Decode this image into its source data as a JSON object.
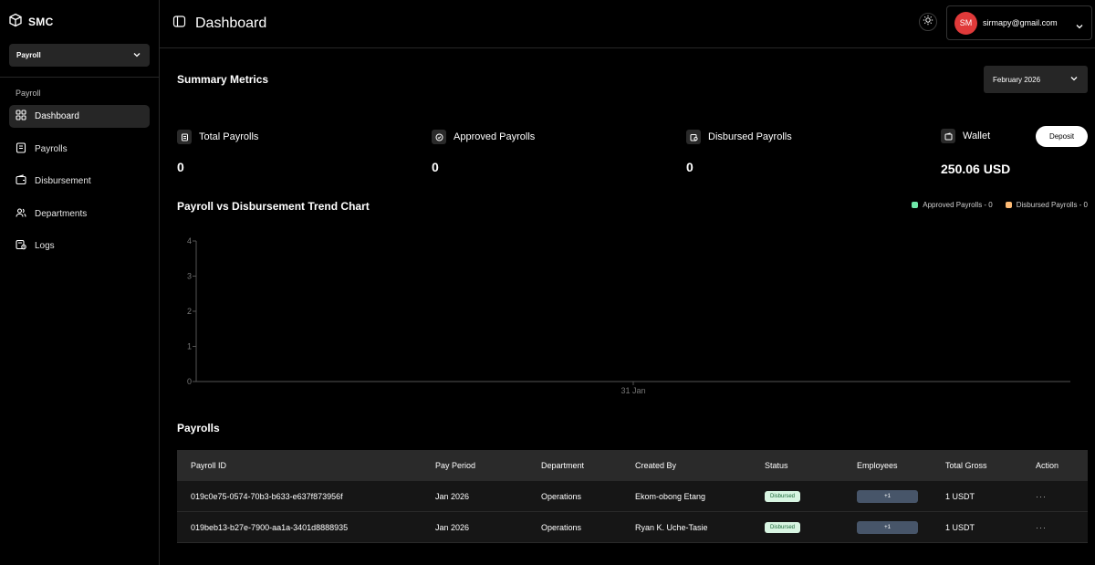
{
  "brand": {
    "name": "SMC"
  },
  "org_select": {
    "value": "Payroll"
  },
  "sidebar": {
    "section_label": "Payroll",
    "items": [
      {
        "label": "Dashboard",
        "icon": "grid-icon",
        "active": true
      },
      {
        "label": "Payrolls",
        "icon": "receipt-icon"
      },
      {
        "label": "Disbursement",
        "icon": "wallet-icon"
      },
      {
        "label": "Departments",
        "icon": "users-icon"
      },
      {
        "label": "Logs",
        "icon": "logs-icon"
      }
    ]
  },
  "header": {
    "title": "Dashboard",
    "user_initials": "SM",
    "user_email": "sirmapy@gmail.com"
  },
  "summary": {
    "title": "Summary Metrics",
    "month": "February 2026",
    "metrics": [
      {
        "label": "Total Payrolls",
        "value": "0"
      },
      {
        "label": "Approved Payrolls",
        "value": "0"
      },
      {
        "label": "Disbursed Payrolls",
        "value": "0"
      },
      {
        "label": "Wallet",
        "value": "250.06 USD"
      }
    ],
    "deposit_label": "Deposit"
  },
  "chart": {
    "title": "Payroll vs Disbursement Trend Chart",
    "legend": [
      {
        "label": "Approved Payrolls - 0",
        "color": "#6ee7a8"
      },
      {
        "label": "Disbursed Payrolls - 0",
        "color": "#fdba74"
      }
    ]
  },
  "chart_data": {
    "type": "line",
    "title": "Payroll vs Disbursement Trend Chart",
    "categories": [
      "31 Jan"
    ],
    "series": [
      {
        "name": "Approved Payrolls",
        "values": [
          0
        ]
      },
      {
        "name": "Disbursed Payrolls",
        "values": [
          0
        ]
      }
    ],
    "ylim": [
      0,
      4
    ],
    "yticks": [
      "0",
      "1",
      "2",
      "3",
      "4"
    ],
    "grid": false,
    "legend_position": "top-right"
  },
  "payrolls": {
    "title": "Payrolls",
    "columns": [
      "Payroll ID",
      "Pay Period",
      "Department",
      "Created By",
      "Status",
      "Employees",
      "Total Gross",
      "Action"
    ],
    "rows": [
      {
        "id": "019c0e75-0574-70b3-b633-e637f873956f",
        "period": "Jan 2026",
        "department": "Operations",
        "created_by": "Ekom-obong Etang",
        "status": "Disbursed",
        "employees": "+1",
        "gross": "1 USDT",
        "action": "···"
      },
      {
        "id": "019beb13-b27e-7900-aa1a-3401d8888935",
        "period": "Jan 2026",
        "department": "Operations",
        "created_by": "Ryan K. Uche-Tasie",
        "status": "Disbursed",
        "employees": "+1",
        "gross": "1 USDT",
        "action": "···"
      }
    ]
  }
}
